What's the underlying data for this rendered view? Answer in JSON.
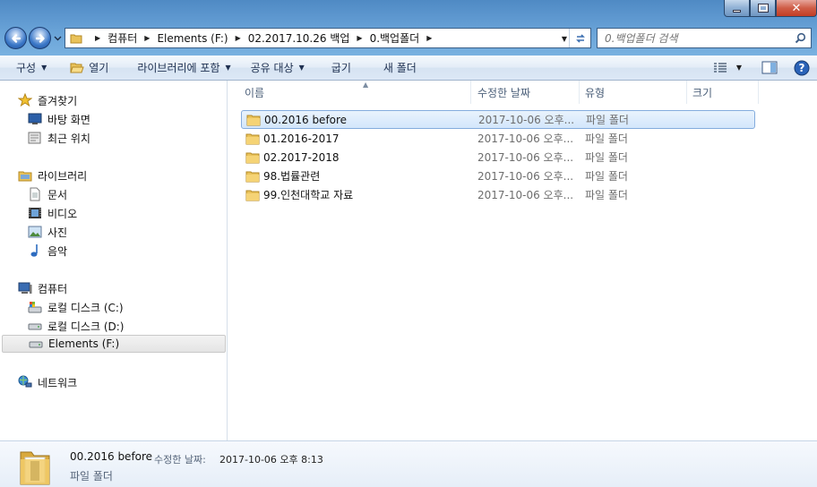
{
  "window": {
    "controls": [
      "minimize-icon",
      "maximize-icon",
      "close-icon"
    ]
  },
  "address": {
    "crumbs": [
      "컴퓨터",
      "Elements (F:)",
      "02.2017.10.26 백업",
      "0.백업폴더"
    ]
  },
  "search": {
    "placeholder": "0.백업폴더 검색"
  },
  "toolbar": {
    "organize": "구성",
    "open": "열기",
    "include_library": "라이브러리에 포함",
    "share_with": "공유 대상",
    "burn": "굽기",
    "new_folder": "새 폴더"
  },
  "nav": {
    "favorites": "즐겨찾기",
    "desktop": "바탕 화면",
    "recent": "최근 위치",
    "libraries": "라이브러리",
    "documents": "문서",
    "videos": "비디오",
    "pictures": "사진",
    "music": "음악",
    "computer": "컴퓨터",
    "drive_c": "로컬 디스크 (C:)",
    "drive_d": "로컬 디스크 (D:)",
    "drive_f": "Elements (F:)",
    "network": "네트워크"
  },
  "columns": {
    "name": "이름",
    "date": "수정한 날짜",
    "type": "유형",
    "size": "크기"
  },
  "files": [
    {
      "name": "00.2016 before",
      "date": "2017-10-06 오후...",
      "type": "파일 폴더"
    },
    {
      "name": "01.2016-2017",
      "date": "2017-10-06 오후...",
      "type": "파일 폴더"
    },
    {
      "name": "02.2017-2018",
      "date": "2017-10-06 오후...",
      "type": "파일 폴더"
    },
    {
      "name": "98.법률관련",
      "date": "2017-10-06 오후...",
      "type": "파일 폴더"
    },
    {
      "name": "99.인천대학교 자료",
      "date": "2017-10-06 오후...",
      "type": "파일 폴더"
    }
  ],
  "details": {
    "name": "00.2016 before",
    "date_label": "수정한 날짜:",
    "date_value": "2017-10-06 오후 8:13",
    "type": "파일 폴더"
  }
}
